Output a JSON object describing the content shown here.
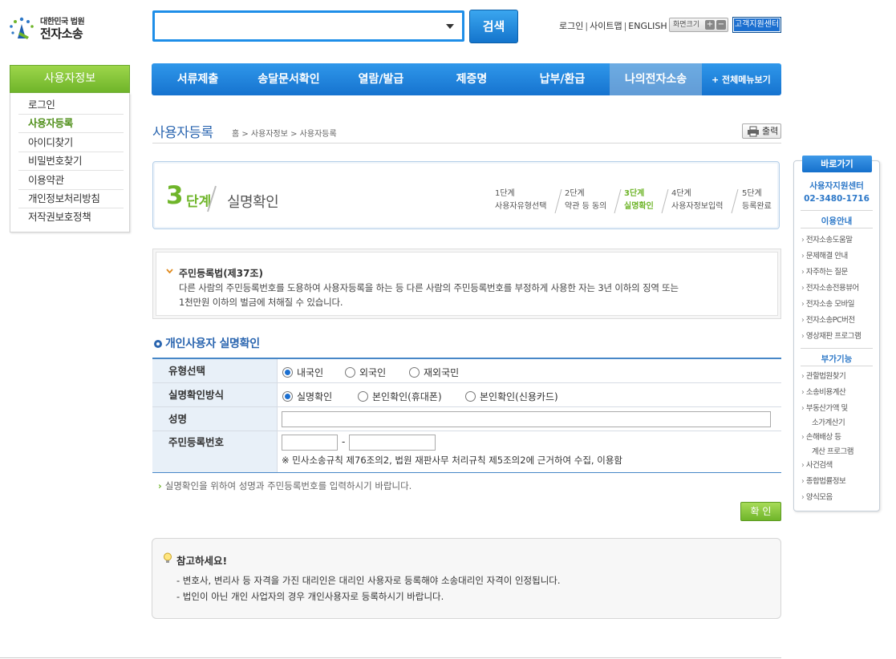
{
  "logo": {
    "court": "대한민국 법원",
    "name": "전자소송"
  },
  "search": {
    "value": "",
    "button": "검색"
  },
  "util": {
    "login": "로그인",
    "sitemap": "사이트맵",
    "english": "ENGLISH",
    "font_size": "화면크기",
    "zoom_in": "+",
    "zoom_out": "−",
    "support": "고객지원센터"
  },
  "nav": {
    "items": [
      {
        "label": "서류제출"
      },
      {
        "label": "송달문서확인"
      },
      {
        "label": "열람/발급"
      },
      {
        "label": "제증명"
      },
      {
        "label": "납부/환급"
      },
      {
        "label": "나의전자소송"
      }
    ],
    "all_menu": "+ 전체메뉴보기"
  },
  "sidebar": {
    "title": "사용자정보",
    "items": [
      {
        "label": "로그인"
      },
      {
        "label": "사용자등록"
      },
      {
        "label": "아이디찾기"
      },
      {
        "label": "비밀번호찾기"
      },
      {
        "label": "이용약관"
      },
      {
        "label": "개인정보처리방침"
      },
      {
        "label": "저작권보호정책"
      }
    ]
  },
  "page": {
    "title": "사용자등록",
    "breadcrumb": "홈 > 사용자정보 > 사용자등록",
    "print": "출력"
  },
  "step": {
    "num": "3",
    "word": "단계",
    "name": "실명확인",
    "steps": [
      {
        "no": "1단계",
        "label": "사용자유형선택"
      },
      {
        "no": "2단계",
        "label": "약관 등 동의"
      },
      {
        "no": "3단계",
        "label": "실명확인"
      },
      {
        "no": "4단계",
        "label": "사용자정보입력"
      },
      {
        "no": "5단계",
        "label": "등록완료"
      }
    ]
  },
  "law": {
    "title": "주민등록법(제37조)",
    "line1": "다른 사람의 주민등록번호를 도용하여 사용자등록을 하는 등 다른 사람의 주민등록번호를 부정하게 사용한 자는 3년 이하의 징역 또는",
    "line2": "1천만원 이하의 벌금에 처해질 수 있습니다."
  },
  "form": {
    "title": "개인사용자 실명확인",
    "type_label": "유형선택",
    "type_options": [
      "내국인",
      "외국인",
      "재외국민"
    ],
    "method_label": "실명확인방식",
    "method_options": [
      "실명확인",
      "본인확인(휴대폰)",
      "본인확인(신용카드)"
    ],
    "name_label": "성명",
    "name_value": "",
    "rrn_label": "주민등록번호",
    "rrn_dash": "-",
    "rrn_note": "※ 민사소송규칙 제76조의2, 법원 재판사무 처리규칙 제5조의2에 근거하여 수집, 이용함",
    "info": "실명확인을 위하여 성명과 주민등록번호를 입력하시기 바랍니다.",
    "confirm": "확 인"
  },
  "note": {
    "title": "참고하세요!",
    "line1": "- 변호사, 변리사 등 자격을 가진 대리인은 대리인 사용자로 등록해야 소송대리인 자격이 인정됩니다.",
    "line2": "- 법인이 아닌 개인 사업자의 경우 개인사용자로 등록하시기 바랍니다."
  },
  "quick": {
    "head": "바로가기",
    "center": "사용자지원센터",
    "phone": "02-3480-1716",
    "sec1": "이용안내",
    "items1": [
      "전자소송도움말",
      "문제해결 안내",
      "자주하는 질문",
      "전자소송전용뷰어",
      "전자소송 모바일",
      "전자소송PC버전",
      "영상재판 프로그램"
    ],
    "sec2": "부가기능",
    "items2": [
      "관할법원찾기",
      "소송비용계산",
      "부동산가액 및",
      "소가계산기",
      "손해배상 등",
      "계산 프로그램",
      "사건검색",
      "종합법률정보",
      "양식모음"
    ]
  },
  "colors": {
    "brand_blue": "#1b6fd0",
    "accent_green": "#6fb52a",
    "label_bg": "#e8f0f8"
  }
}
